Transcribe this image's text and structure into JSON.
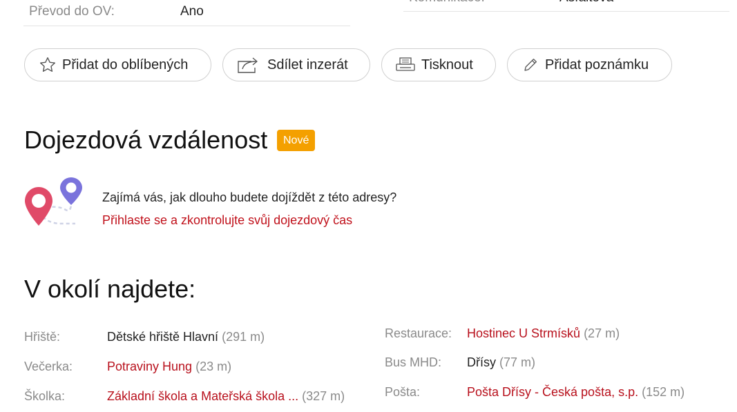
{
  "top_row_left": {
    "label": "Převod do OV:",
    "value": "Ano"
  },
  "top_row_right": {
    "label": "Komunikace:",
    "value": "Asfaltová"
  },
  "actions": {
    "favorite": "Přidat do oblíbených",
    "share": "Sdílet inzerát",
    "print": "Tisknout",
    "note": "Přidat poznámku"
  },
  "commute": {
    "title": "Dojezdová vzdálenost",
    "badge": "Nové",
    "question": "Zajímá vás, jak dlouho budete dojíždět z této adresy?",
    "link": "Přihlaste se a zkontrolujte svůj dojezdový čas"
  },
  "nearby": {
    "title": "V okolí najdete:",
    "left": [
      {
        "label": "Hřiště:",
        "name": "Dětské hřiště Hlavní",
        "distance": "(291 m)",
        "link": false
      },
      {
        "label": "Večerka:",
        "name": "Potraviny Hung",
        "distance": "(23 m)",
        "link": true
      },
      {
        "label": "Školka:",
        "name": "Základní škola a Mateřská škola ...",
        "distance": "(327 m)",
        "link": true
      }
    ],
    "right": [
      {
        "label": "Restaurace:",
        "name": "Hostinec U Strmísků",
        "distance": "(27 m)",
        "link": true
      },
      {
        "label": "Bus MHD:",
        "name": "Dřísy",
        "distance": "(77 m)",
        "link": false
      },
      {
        "label": "Pošta:",
        "name": "Pošta Dřísy - Česká pošta, s.p.",
        "distance": "(152 m)",
        "link": true
      }
    ]
  },
  "colors": {
    "link_red": "#b8101c",
    "badge_orange": "#f4a000",
    "muted_gray": "#8a8a8a"
  },
  "icons": [
    "star-icon",
    "share-icon",
    "printer-icon",
    "pencil-icon",
    "commute-pins-icon"
  ]
}
